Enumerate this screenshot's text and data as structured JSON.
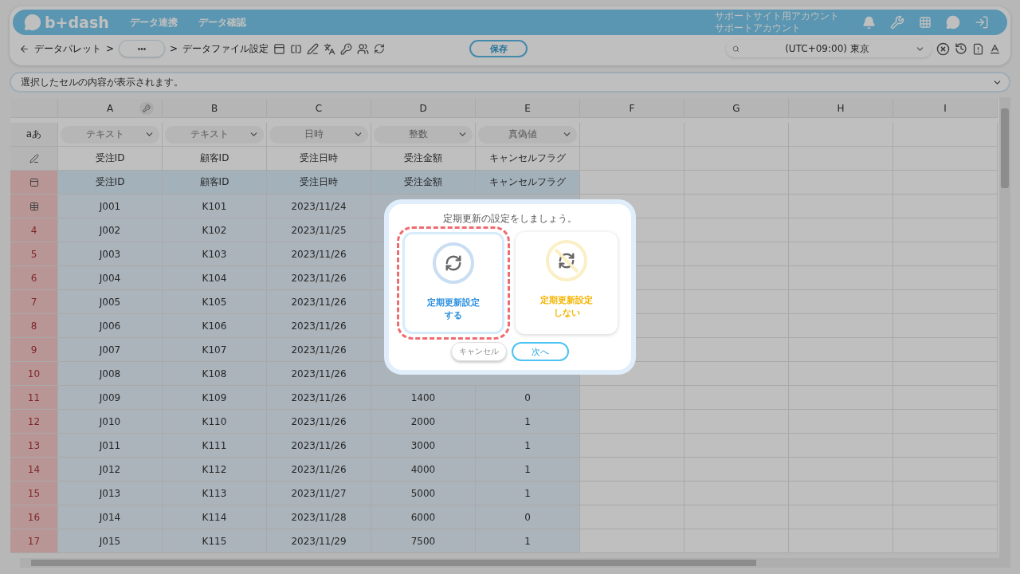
{
  "header": {
    "logo": "b+dash",
    "nav": [
      "データ連携",
      "データ確認"
    ],
    "account": [
      "サポートサイト用アカウント",
      "サポートアカウント"
    ]
  },
  "toolbar": {
    "breadcrumb": [
      {
        "kind": "link",
        "text": "データパレット"
      },
      {
        "kind": "sep",
        "text": ">"
      },
      {
        "kind": "more",
        "text": "•••"
      },
      {
        "kind": "sep",
        "text": ">"
      },
      {
        "kind": "current",
        "text": "データファイル設定"
      }
    ],
    "save": "保存",
    "timezone": "(UTC+09:00) 東京"
  },
  "cell_viewer": {
    "placeholder": "選択したセルの内容が表示されます。"
  },
  "grid": {
    "columns": [
      {
        "letter": "A",
        "key": true
      },
      {
        "letter": "B",
        "key": false
      },
      {
        "letter": "C",
        "key": false
      },
      {
        "letter": "D",
        "key": false
      },
      {
        "letter": "E",
        "key": false
      },
      {
        "letter": "F",
        "key": false
      },
      {
        "letter": "G",
        "key": false
      },
      {
        "letter": "H",
        "key": false
      },
      {
        "letter": "I",
        "key": false
      }
    ],
    "type_label": "aあ",
    "types": [
      "テキスト",
      "テキスト",
      "日時",
      "整数",
      "真偽値"
    ],
    "display_names": [
      "受注ID",
      "顧客ID",
      "受注日時",
      "受注金額",
      "キャンセルフラグ"
    ],
    "physical_names": [
      "受注ID",
      "顧客ID",
      "受注日時",
      "受注金額",
      "キャンセルフラグ"
    ],
    "rows": [
      {
        "kind": "icon",
        "cells": [
          "J001",
          "K101",
          "2023/11/24"
        ]
      },
      {
        "kind": "number",
        "label": "4",
        "cells": [
          "J002",
          "K102",
          "2023/11/25"
        ]
      },
      {
        "kind": "number",
        "label": "5",
        "cells": [
          "J003",
          "K103",
          "2023/11/26"
        ]
      },
      {
        "kind": "number",
        "label": "6",
        "cells": [
          "J004",
          "K104",
          "2023/11/26"
        ]
      },
      {
        "kind": "number",
        "label": "7",
        "cells": [
          "J005",
          "K105",
          "2023/11/26"
        ]
      },
      {
        "kind": "number",
        "label": "8",
        "cells": [
          "J006",
          "K106",
          "2023/11/26"
        ]
      },
      {
        "kind": "number",
        "label": "9",
        "cells": [
          "J007",
          "K107",
          "2023/11/26"
        ]
      },
      {
        "kind": "number",
        "label": "10",
        "cells": [
          "J008",
          "K108",
          "2023/11/26"
        ]
      },
      {
        "kind": "number",
        "label": "11",
        "cells": [
          "J009",
          "K109",
          "2023/11/26",
          "1400",
          "0"
        ]
      },
      {
        "kind": "number",
        "label": "12",
        "cells": [
          "J010",
          "K110",
          "2023/11/26",
          "2000",
          "1"
        ]
      },
      {
        "kind": "number",
        "label": "13",
        "cells": [
          "J011",
          "K111",
          "2023/11/26",
          "3000",
          "1"
        ]
      },
      {
        "kind": "number",
        "label": "14",
        "cells": [
          "J012",
          "K112",
          "2023/11/26",
          "4000",
          "1"
        ]
      },
      {
        "kind": "number",
        "label": "15",
        "cells": [
          "J013",
          "K113",
          "2023/11/27",
          "5000",
          "1"
        ]
      },
      {
        "kind": "number",
        "label": "16",
        "cells": [
          "J014",
          "K114",
          "2023/11/28",
          "6000",
          "0"
        ]
      },
      {
        "kind": "number",
        "label": "17",
        "cells": [
          "J015",
          "K115",
          "2023/11/29",
          "7500",
          "1"
        ]
      }
    ]
  },
  "dialog": {
    "title": "定期更新の設定をしましょう。",
    "options": [
      {
        "kind": "on",
        "lines": [
          "定期更新設定",
          "する"
        ],
        "selected": true
      },
      {
        "kind": "off",
        "lines": [
          "定期更新設定",
          "しない"
        ],
        "selected": false
      }
    ],
    "cancel": "キャンセル",
    "next": "次へ"
  }
}
